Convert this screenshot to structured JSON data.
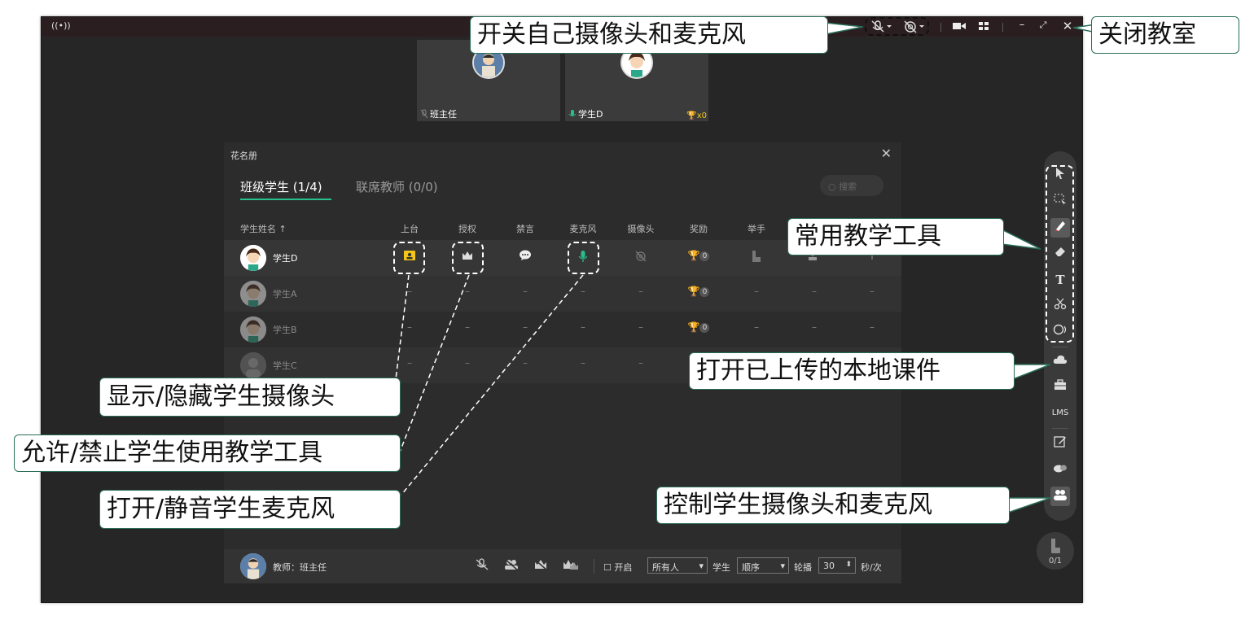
{
  "window": {
    "live_icon": "((•))",
    "controls": {
      "mic": "mic-off-icon",
      "camera": "camera-off-icon",
      "video": "■◀",
      "grid": "▪▪",
      "minimize": "–",
      "restore": "⤢",
      "close": "✕"
    }
  },
  "tiles": [
    {
      "name": "班主任",
      "status": "mic-off"
    },
    {
      "name": "学生D",
      "status": "mic-on",
      "trophy": "x0"
    }
  ],
  "roster": {
    "title": "花名册",
    "tabs": [
      {
        "label": "班级学生 (1/4)",
        "active": true
      },
      {
        "label": "联席教师 (0/0)",
        "active": false
      }
    ],
    "search_placeholder": "搜索",
    "headers": {
      "name": "学生姓名 ↑",
      "stage": "上台",
      "auth": "授权",
      "mute": "禁言",
      "mic": "麦克风",
      "camera": "摄像头",
      "reward": "奖励",
      "hand": "举手"
    },
    "students": [
      {
        "name": "学生D",
        "reward_count": "0",
        "online": true
      },
      {
        "name": "学生A",
        "reward_count": "0",
        "online": false
      },
      {
        "name": "学生B",
        "reward_count": "0",
        "online": false
      },
      {
        "name": "学生C",
        "reward_count": "",
        "online": false
      }
    ],
    "dash": "–",
    "footer": {
      "teacher": "教师：班主任",
      "enable_label": "开启",
      "audience": "所有人",
      "student_label": "学生",
      "order": "顺序",
      "rotate_label": "轮播",
      "seconds": "30",
      "unit": "秒/次"
    }
  },
  "toolbar": {
    "lms": "LMS",
    "hand_count": "0/1"
  },
  "callouts": {
    "self_av": "开关自己摄像头和麦克风",
    "close_room": "关闭教室",
    "common_tools": "常用教学工具",
    "open_courseware": "打开已上传的本地课件",
    "toggle_student_cam": "显示/隐藏学生摄像头",
    "allow_tools": "允许/禁止学生使用教学工具",
    "toggle_student_mic": "打开/静音学生麦克风",
    "control_av": "控制学生摄像头和麦克风"
  },
  "colors": {
    "accent": "#27c08a",
    "callout_border": "#2a6e5a",
    "stage_icon": "#f5c518"
  }
}
